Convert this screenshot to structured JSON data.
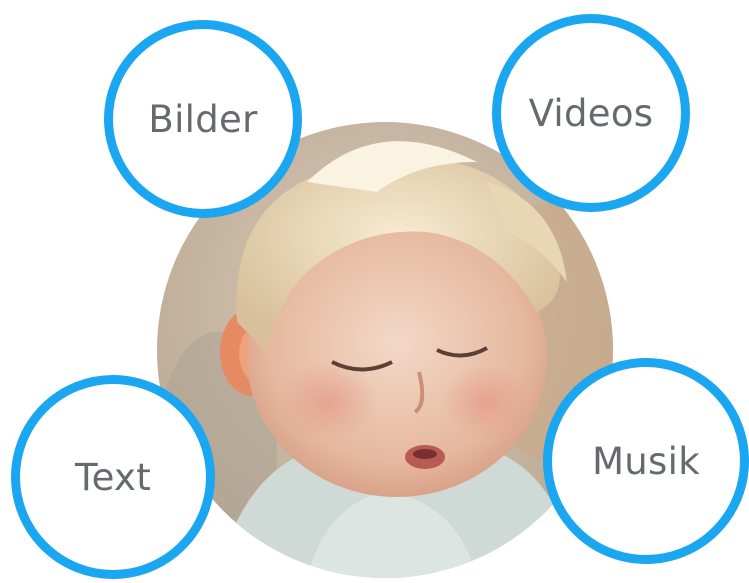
{
  "photo": {
    "description_icon": "child-portrait-image"
  },
  "bubbles": {
    "bilder": "Bilder",
    "videos": "Videos",
    "text": "Text",
    "musik": "Musik"
  },
  "colors": {
    "accent": "#1aa6f0",
    "label": "#666a6e"
  }
}
